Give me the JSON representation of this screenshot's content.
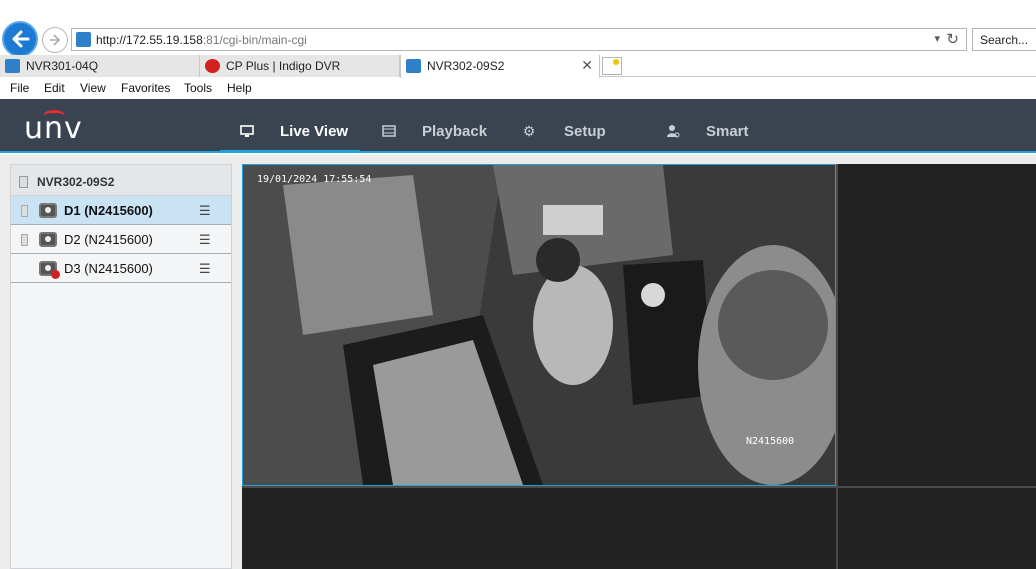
{
  "browser": {
    "url_host": "http://172.55.19.158",
    "url_rest": ":81/cgi-bin/main-cgi",
    "search_placeholder": "Search...",
    "tabs": [
      {
        "label": "NVR301-04Q",
        "icon": "unv-favicon",
        "color": "#2f7fc9"
      },
      {
        "label": "CP Plus | Indigo DVR",
        "icon": "cpplus-favicon",
        "color": "#d32020"
      },
      {
        "label": "NVR302-09S2",
        "icon": "unv-favicon",
        "color": "#2f7fc9"
      }
    ],
    "menu": [
      "File",
      "Edit",
      "View",
      "Favorites",
      "Tools",
      "Help"
    ]
  },
  "app": {
    "logo": "unv",
    "nav": [
      {
        "label": "Live View",
        "icon": "monitor-icon"
      },
      {
        "label": "Playback",
        "icon": "film-icon"
      },
      {
        "label": "Setup",
        "icon": "gear-icon"
      },
      {
        "label": "Smart",
        "icon": "smart-user-icon"
      }
    ]
  },
  "sidebar": {
    "nvr_name": "NVR302-09S2",
    "devices": [
      {
        "label": "D1 (N2415600)",
        "status": "online",
        "selected": true
      },
      {
        "label": "D2 (N2415600)",
        "status": "online",
        "selected": false
      },
      {
        "label": "D3 (N2415600)",
        "status": "offline",
        "selected": false
      }
    ]
  },
  "video": {
    "timestamp": "19/01/2024 17:55:54",
    "camera_label": "N2415600"
  },
  "colors": {
    "accent": "#1fa2dc",
    "header_bg": "#3a4450",
    "selected_row": "#c9e3f5"
  }
}
